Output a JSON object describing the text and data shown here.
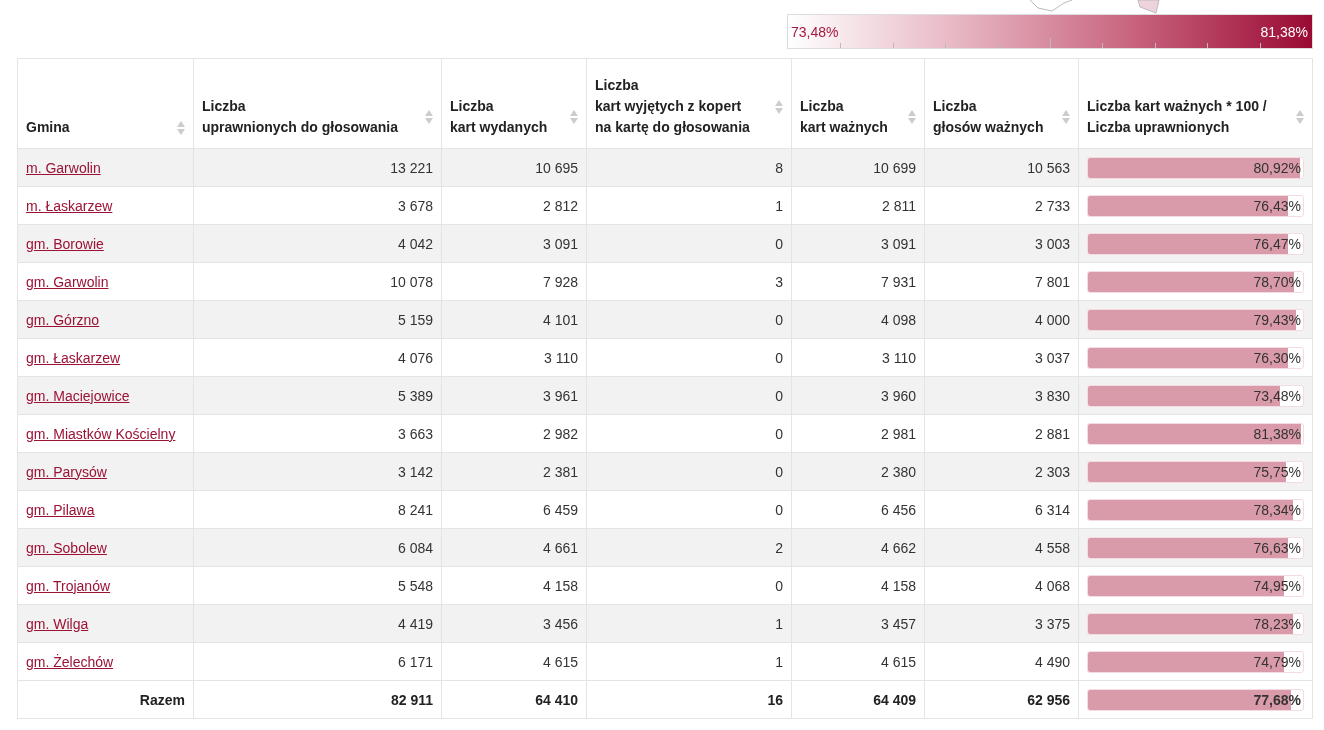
{
  "legend": {
    "min": "73,48%",
    "max": "81,38%"
  },
  "table": {
    "columns": [
      {
        "lines": [
          "Gmina"
        ]
      },
      {
        "lines": [
          "Liczba",
          "uprawnionych do głosowania"
        ]
      },
      {
        "lines": [
          "Liczba",
          "kart wydanych"
        ]
      },
      {
        "lines": [
          "Liczba",
          "kart wyjętych z kopert",
          "na kartę do głosowania"
        ]
      },
      {
        "lines": [
          "Liczba",
          "kart ważnych"
        ]
      },
      {
        "lines": [
          "Liczba",
          "głosów ważnych"
        ]
      },
      {
        "lines": [
          "Liczba kart ważnych * 100 /",
          "Liczba uprawnionych"
        ]
      }
    ],
    "rows": [
      {
        "cells": [
          "m. Garwolin",
          "13 221",
          "10 695",
          "8",
          "10 699",
          "10 563",
          "80,92%"
        ],
        "level": 0.984
      },
      {
        "cells": [
          "m. Łaskarzew",
          "3 678",
          "2 812",
          "1",
          "2 811",
          "2 733",
          "76,43%"
        ],
        "level": 0.93
      },
      {
        "cells": [
          "gm. Borowie",
          "4 042",
          "3 091",
          "0",
          "3 091",
          "3 003",
          "76,47%"
        ],
        "level": 0.93
      },
      {
        "cells": [
          "gm. Garwolin",
          "10 078",
          "7 928",
          "3",
          "7 931",
          "7 801",
          "78,70%"
        ],
        "level": 0.957
      },
      {
        "cells": [
          "gm. Górzno",
          "5 159",
          "4 101",
          "0",
          "4 098",
          "4 000",
          "79,43%"
        ],
        "level": 0.966
      },
      {
        "cells": [
          "gm. Łaskarzew",
          "4 076",
          "3 110",
          "0",
          "3 110",
          "3 037",
          "76,30%"
        ],
        "level": 0.928
      },
      {
        "cells": [
          "gm. Maciejowice",
          "5 389",
          "3 961",
          "0",
          "3 960",
          "3 830",
          "73,48%"
        ],
        "level": 0.894
      },
      {
        "cells": [
          "gm. Miastków Kościelny",
          "3 663",
          "2 982",
          "0",
          "2 981",
          "2 881",
          "81,38%"
        ],
        "level": 0.99
      },
      {
        "cells": [
          "gm. Parysów",
          "3 142",
          "2 381",
          "0",
          "2 380",
          "2 303",
          "75,75%"
        ],
        "level": 0.922
      },
      {
        "cells": [
          "gm. Pilawa",
          "8 241",
          "6 459",
          "0",
          "6 456",
          "6 314",
          "78,34%"
        ],
        "level": 0.953
      },
      {
        "cells": [
          "gm. Sobolew",
          "6 084",
          "4 661",
          "2",
          "4 662",
          "4 558",
          "76,63%"
        ],
        "level": 0.932
      },
      {
        "cells": [
          "gm. Trojanów",
          "5 548",
          "4 158",
          "0",
          "4 158",
          "4 068",
          "74,95%"
        ],
        "level": 0.912
      },
      {
        "cells": [
          "gm. Wilga",
          "4 419",
          "3 456",
          "1",
          "3 457",
          "3 375",
          "78,23%"
        ],
        "level": 0.952
      },
      {
        "cells": [
          "gm. Żelechów",
          "6 171",
          "4 615",
          "1",
          "4 615",
          "4 490",
          "74,79%"
        ],
        "level": 0.91
      },
      {
        "kind": "total",
        "cells": [
          "Razem",
          "82 911",
          "64 410",
          "16",
          "64 409",
          "62 956",
          "77,68%"
        ],
        "level": 0.945
      }
    ]
  }
}
